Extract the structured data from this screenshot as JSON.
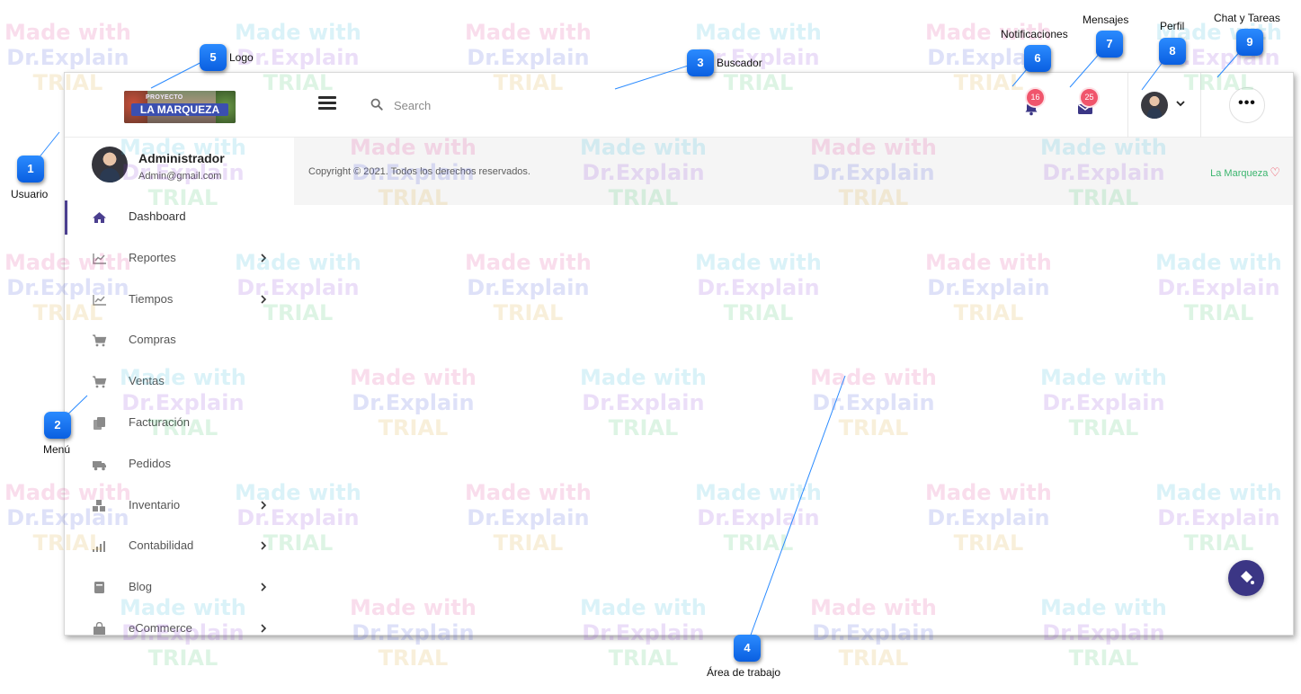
{
  "topbar": {
    "logo_small": "PROYECTO",
    "logo_text": "LA MARQUEZA",
    "search_placeholder": "Search",
    "notifications_count": "16",
    "messages_count": "25",
    "more_label": "•••"
  },
  "user": {
    "name": "Administrador",
    "email": "Admin@gmail.com"
  },
  "footer": {
    "copyright": "Copyright © 2021. Todos los derechos reservados.",
    "brand": "La Marqueza"
  },
  "menu": [
    {
      "label": "Dashboard",
      "icon": "home-icon",
      "has_submenu": false,
      "active": true
    },
    {
      "label": "Reportes",
      "icon": "chart-line-icon",
      "has_submenu": true
    },
    {
      "label": "Tiempos",
      "icon": "chart-line-icon",
      "has_submenu": true
    },
    {
      "label": "Compras",
      "icon": "cart-icon",
      "has_submenu": false
    },
    {
      "label": "Ventas",
      "icon": "cart-icon",
      "has_submenu": false
    },
    {
      "label": "Facturación",
      "icon": "documents-icon",
      "has_submenu": false
    },
    {
      "label": "Pedidos",
      "icon": "truck-icon",
      "has_submenu": false
    },
    {
      "label": "Inventario",
      "icon": "boxes-icon",
      "has_submenu": true
    },
    {
      "label": "Contabilidad",
      "icon": "signal-bars-icon",
      "has_submenu": true
    },
    {
      "label": "Blog",
      "icon": "book-icon",
      "has_submenu": true
    },
    {
      "label": "eCommerce",
      "icon": "shopping-bag-icon",
      "has_submenu": true
    }
  ],
  "callouts": [
    {
      "number": "1",
      "label": "Usuario"
    },
    {
      "number": "2",
      "label": "Menú"
    },
    {
      "number": "3",
      "label": "Buscador"
    },
    {
      "number": "4",
      "label": "Área de trabajo"
    },
    {
      "number": "5",
      "label": "Logo"
    },
    {
      "number": "6",
      "label": "Notificaciones"
    },
    {
      "number": "7",
      "label": "Mensajes"
    },
    {
      "number": "8",
      "label": "Perfil"
    },
    {
      "number": "9",
      "label": "Chat y Tareas"
    }
  ],
  "watermark": {
    "line1": "Made with",
    "line2": "Dr.Explain",
    "line3": "TRIAL"
  },
  "colors": {
    "accent": "#4b3f8f",
    "badge": "#f0556c",
    "brand_link": "#3bb56e",
    "callout": "#0a5fe0"
  }
}
